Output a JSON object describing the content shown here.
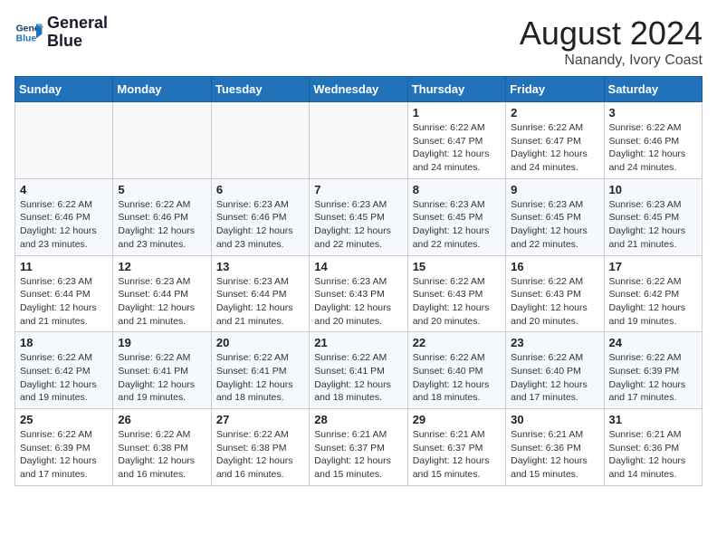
{
  "header": {
    "logo_line1": "General",
    "logo_line2": "Blue",
    "month": "August 2024",
    "location": "Nanandy, Ivory Coast"
  },
  "days_of_week": [
    "Sunday",
    "Monday",
    "Tuesday",
    "Wednesday",
    "Thursday",
    "Friday",
    "Saturday"
  ],
  "weeks": [
    [
      {
        "day": "",
        "info": ""
      },
      {
        "day": "",
        "info": ""
      },
      {
        "day": "",
        "info": ""
      },
      {
        "day": "",
        "info": ""
      },
      {
        "day": "1",
        "info": "Sunrise: 6:22 AM\nSunset: 6:47 PM\nDaylight: 12 hours\nand 24 minutes."
      },
      {
        "day": "2",
        "info": "Sunrise: 6:22 AM\nSunset: 6:47 PM\nDaylight: 12 hours\nand 24 minutes."
      },
      {
        "day": "3",
        "info": "Sunrise: 6:22 AM\nSunset: 6:46 PM\nDaylight: 12 hours\nand 24 minutes."
      }
    ],
    [
      {
        "day": "4",
        "info": "Sunrise: 6:22 AM\nSunset: 6:46 PM\nDaylight: 12 hours\nand 23 minutes."
      },
      {
        "day": "5",
        "info": "Sunrise: 6:22 AM\nSunset: 6:46 PM\nDaylight: 12 hours\nand 23 minutes."
      },
      {
        "day": "6",
        "info": "Sunrise: 6:23 AM\nSunset: 6:46 PM\nDaylight: 12 hours\nand 23 minutes."
      },
      {
        "day": "7",
        "info": "Sunrise: 6:23 AM\nSunset: 6:45 PM\nDaylight: 12 hours\nand 22 minutes."
      },
      {
        "day": "8",
        "info": "Sunrise: 6:23 AM\nSunset: 6:45 PM\nDaylight: 12 hours\nand 22 minutes."
      },
      {
        "day": "9",
        "info": "Sunrise: 6:23 AM\nSunset: 6:45 PM\nDaylight: 12 hours\nand 22 minutes."
      },
      {
        "day": "10",
        "info": "Sunrise: 6:23 AM\nSunset: 6:45 PM\nDaylight: 12 hours\nand 21 minutes."
      }
    ],
    [
      {
        "day": "11",
        "info": "Sunrise: 6:23 AM\nSunset: 6:44 PM\nDaylight: 12 hours\nand 21 minutes."
      },
      {
        "day": "12",
        "info": "Sunrise: 6:23 AM\nSunset: 6:44 PM\nDaylight: 12 hours\nand 21 minutes."
      },
      {
        "day": "13",
        "info": "Sunrise: 6:23 AM\nSunset: 6:44 PM\nDaylight: 12 hours\nand 21 minutes."
      },
      {
        "day": "14",
        "info": "Sunrise: 6:23 AM\nSunset: 6:43 PM\nDaylight: 12 hours\nand 20 minutes."
      },
      {
        "day": "15",
        "info": "Sunrise: 6:22 AM\nSunset: 6:43 PM\nDaylight: 12 hours\nand 20 minutes."
      },
      {
        "day": "16",
        "info": "Sunrise: 6:22 AM\nSunset: 6:43 PM\nDaylight: 12 hours\nand 20 minutes."
      },
      {
        "day": "17",
        "info": "Sunrise: 6:22 AM\nSunset: 6:42 PM\nDaylight: 12 hours\nand 19 minutes."
      }
    ],
    [
      {
        "day": "18",
        "info": "Sunrise: 6:22 AM\nSunset: 6:42 PM\nDaylight: 12 hours\nand 19 minutes."
      },
      {
        "day": "19",
        "info": "Sunrise: 6:22 AM\nSunset: 6:41 PM\nDaylight: 12 hours\nand 19 minutes."
      },
      {
        "day": "20",
        "info": "Sunrise: 6:22 AM\nSunset: 6:41 PM\nDaylight: 12 hours\nand 18 minutes."
      },
      {
        "day": "21",
        "info": "Sunrise: 6:22 AM\nSunset: 6:41 PM\nDaylight: 12 hours\nand 18 minutes."
      },
      {
        "day": "22",
        "info": "Sunrise: 6:22 AM\nSunset: 6:40 PM\nDaylight: 12 hours\nand 18 minutes."
      },
      {
        "day": "23",
        "info": "Sunrise: 6:22 AM\nSunset: 6:40 PM\nDaylight: 12 hours\nand 17 minutes."
      },
      {
        "day": "24",
        "info": "Sunrise: 6:22 AM\nSunset: 6:39 PM\nDaylight: 12 hours\nand 17 minutes."
      }
    ],
    [
      {
        "day": "25",
        "info": "Sunrise: 6:22 AM\nSunset: 6:39 PM\nDaylight: 12 hours\nand 17 minutes."
      },
      {
        "day": "26",
        "info": "Sunrise: 6:22 AM\nSunset: 6:38 PM\nDaylight: 12 hours\nand 16 minutes."
      },
      {
        "day": "27",
        "info": "Sunrise: 6:22 AM\nSunset: 6:38 PM\nDaylight: 12 hours\nand 16 minutes."
      },
      {
        "day": "28",
        "info": "Sunrise: 6:21 AM\nSunset: 6:37 PM\nDaylight: 12 hours\nand 15 minutes."
      },
      {
        "day": "29",
        "info": "Sunrise: 6:21 AM\nSunset: 6:37 PM\nDaylight: 12 hours\nand 15 minutes."
      },
      {
        "day": "30",
        "info": "Sunrise: 6:21 AM\nSunset: 6:36 PM\nDaylight: 12 hours\nand 15 minutes."
      },
      {
        "day": "31",
        "info": "Sunrise: 6:21 AM\nSunset: 6:36 PM\nDaylight: 12 hours\nand 14 minutes."
      }
    ]
  ]
}
